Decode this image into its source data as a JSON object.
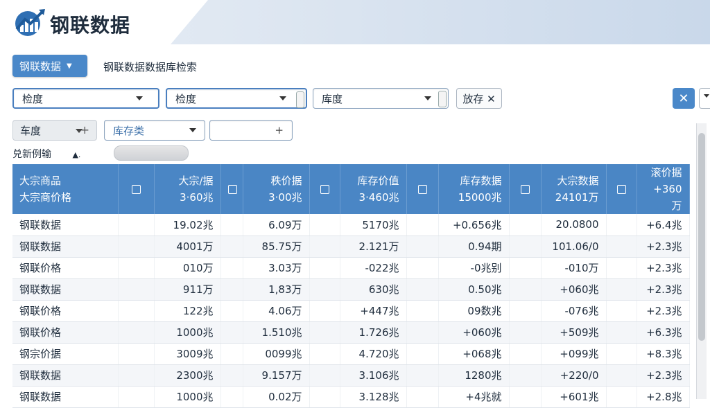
{
  "app": {
    "title": "钢联数据"
  },
  "toolbar": {
    "db_button_label": "钢联数据",
    "db_label": "钢联数据数据库检索"
  },
  "filters": {
    "select1": "检度",
    "select2": "检度",
    "select3": "库度",
    "stock_button": "放存 ✕",
    "close_icon": "✕",
    "chip1": "车度",
    "chip1_plus": "+",
    "select4": "库存类",
    "select5_plus": "+",
    "note": "兑新例输",
    "note_mark": "▲."
  },
  "table": {
    "columns": [
      {
        "line1": "大宗商品",
        "line2": "大宗商价格",
        "type": "name"
      },
      {
        "type": "check"
      },
      {
        "line1": "大宗/据",
        "line2": "3·60兆",
        "type": "num"
      },
      {
        "type": "check"
      },
      {
        "line1": "秩价据",
        "line2": "3·00兆",
        "type": "num"
      },
      {
        "type": "check"
      },
      {
        "line1": "库存价值",
        "line2": "3·460兆",
        "type": "num"
      },
      {
        "type": "check"
      },
      {
        "line1": "库存数据",
        "line2": "15000兆",
        "type": "num"
      },
      {
        "type": "check"
      },
      {
        "line1": "大宗数据",
        "line2": "24101万",
        "type": "num"
      },
      {
        "type": "check"
      },
      {
        "line1": "滚价据",
        "line2": "+360万",
        "type": "num"
      }
    ],
    "rows": [
      [
        "钢联数据",
        "19.02兆",
        "6.09万",
        "5170兆",
        "+0.656兆",
        "20.0800",
        "+6.4兆"
      ],
      [
        "钢联数据",
        "4001万",
        "85.75万",
        "2.121万",
        "0.94期",
        "101.06/0",
        "+2.3兆"
      ],
      [
        "钢联价格",
        "010万",
        "3.03万",
        "-022兆",
        "-0兆别",
        "-010万",
        "+2.3兆"
      ],
      [
        "钢联数据",
        "911万",
        "1,83万",
        "630兆",
        "0.50兆",
        "+060兆",
        "+2.3兆"
      ],
      [
        "钢联价格",
        "122兆",
        "4.06万",
        "+447兆",
        "09数兆",
        "-076兆",
        "+2.3兆"
      ],
      [
        "钢联价格",
        "1000兆",
        "1.510兆",
        "1.726兆",
        "+060兆",
        "+509兆",
        "+6.3兆"
      ],
      [
        "钢宗价据",
        "3009兆",
        "0099兆",
        "4.720兆",
        "+068兆",
        "+099兆",
        "+8.3兆"
      ],
      [
        "钢联数据",
        "2300兆",
        "9.157万",
        "3.106兆",
        "1280兆",
        "+220/0",
        "+2.3兆"
      ],
      [
        "钢联数据",
        "1000兆",
        "0.02万",
        "3.128兆",
        "+4兆就",
        "+601兆",
        "+2.8兆"
      ]
    ]
  },
  "colors": {
    "accent": "#4a88c9",
    "table_header": "#4a86c5"
  }
}
